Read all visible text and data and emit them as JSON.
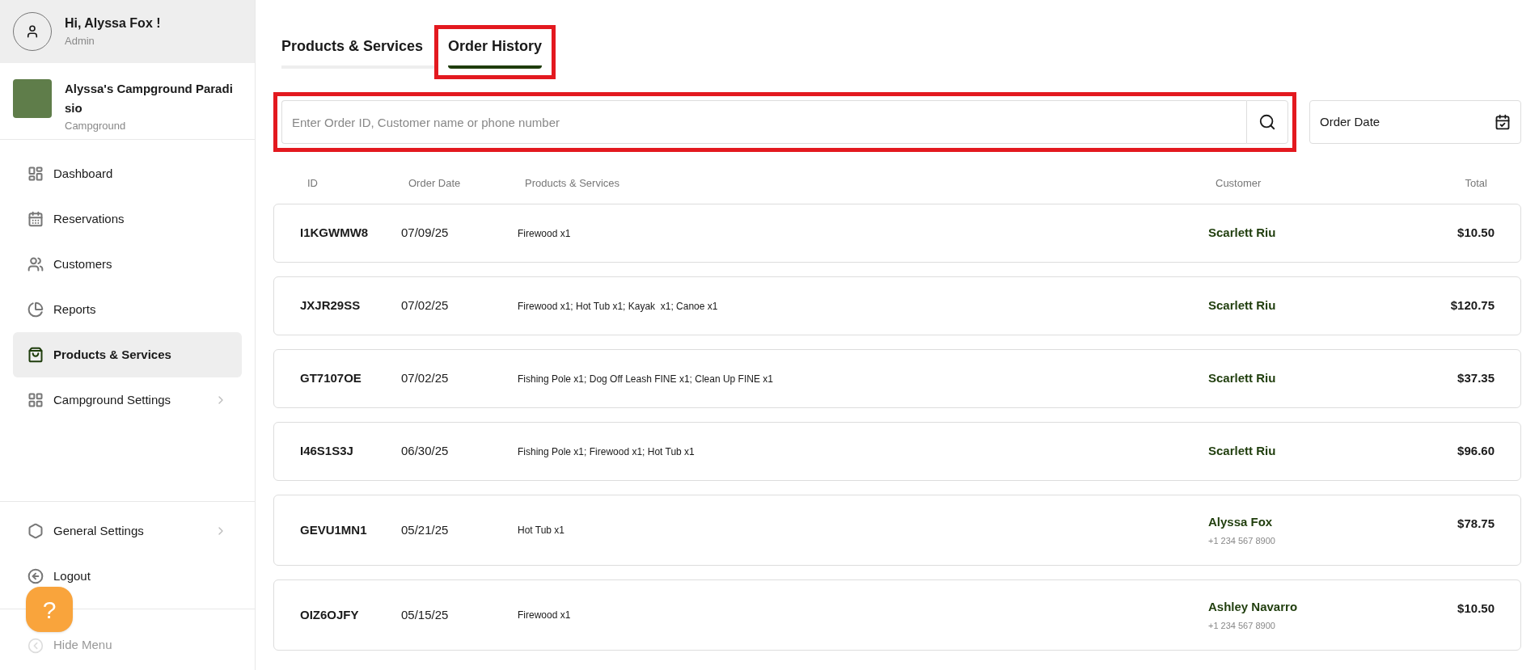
{
  "user": {
    "greeting": "Hi, Alyssa Fox !",
    "role": "Admin"
  },
  "campground": {
    "name": "Alyssa's Campground Paradisio",
    "type": "Campground"
  },
  "nav": [
    {
      "label": "Dashboard",
      "selected": false,
      "chevron": false
    },
    {
      "label": "Reservations",
      "selected": false,
      "chevron": false
    },
    {
      "label": "Customers",
      "selected": false,
      "chevron": false
    },
    {
      "label": "Reports",
      "selected": false,
      "chevron": false
    },
    {
      "label": "Products & Services",
      "selected": true,
      "chevron": false
    },
    {
      "label": "Campground Settings",
      "selected": false,
      "chevron": true
    }
  ],
  "bottom_nav": [
    {
      "label": "General Settings",
      "chevron": true
    },
    {
      "label": "Logout",
      "chevron": false
    }
  ],
  "hide_menu": "Hide Menu",
  "help_button": "?",
  "tabs": [
    {
      "label": "Products & Services",
      "selected": false,
      "highlighted": false
    },
    {
      "label": "Order History",
      "selected": true,
      "highlighted": true
    }
  ],
  "search": {
    "placeholder": "Enter Order ID, Customer name or phone number",
    "highlighted": true
  },
  "date_filter": {
    "label": "Order Date"
  },
  "table": {
    "columns": [
      "ID",
      "Order Date",
      "Products & Services",
      "Customer",
      "Total"
    ],
    "rows": [
      {
        "id": "I1KGWMW8",
        "date": "07/09/25",
        "items": "Firewood x1",
        "customer": "Scarlett Riu",
        "total": "$10.50"
      },
      {
        "id": "JXJR29SS",
        "date": "07/02/25",
        "items": "Firewood x1; Hot Tub x1; Kayak  x1; Canoe x1",
        "customer": "Scarlett Riu",
        "total": "$120.75"
      },
      {
        "id": "GT7107OE",
        "date": "07/02/25",
        "items": "Fishing Pole x1; Dog Off Leash FINE x1; Clean Up FINE x1",
        "customer": "Scarlett Riu",
        "total": "$37.35"
      },
      {
        "id": "I46S1S3J",
        "date": "06/30/25",
        "items": "Fishing Pole x1; Firewood x1; Hot Tub x1",
        "customer": "Scarlett Riu",
        "total": "$96.60"
      },
      {
        "id": "GEVU1MN1",
        "date": "05/21/25",
        "items": "Hot Tub x1",
        "customer": "Alyssa Fox",
        "phone": "+1 234 567 8900",
        "total": "$78.75"
      },
      {
        "id": "OIZ6OJFY",
        "date": "05/15/25",
        "items": "Firewood x1",
        "customer": "Ashley Navarro",
        "phone": "+1 234 567 8900",
        "total": "$10.50"
      }
    ]
  }
}
